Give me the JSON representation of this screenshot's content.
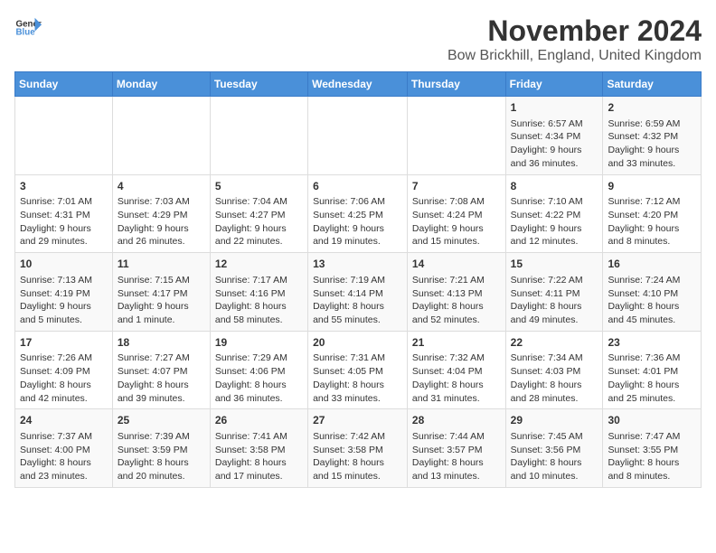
{
  "header": {
    "logo_general": "General",
    "logo_blue": "Blue",
    "month_year": "November 2024",
    "location": "Bow Brickhill, England, United Kingdom"
  },
  "weekdays": [
    "Sunday",
    "Monday",
    "Tuesday",
    "Wednesday",
    "Thursday",
    "Friday",
    "Saturday"
  ],
  "weeks": [
    [
      {
        "day": "",
        "info": ""
      },
      {
        "day": "",
        "info": ""
      },
      {
        "day": "",
        "info": ""
      },
      {
        "day": "",
        "info": ""
      },
      {
        "day": "",
        "info": ""
      },
      {
        "day": "1",
        "info": "Sunrise: 6:57 AM\nSunset: 4:34 PM\nDaylight: 9 hours and 36 minutes."
      },
      {
        "day": "2",
        "info": "Sunrise: 6:59 AM\nSunset: 4:32 PM\nDaylight: 9 hours and 33 minutes."
      }
    ],
    [
      {
        "day": "3",
        "info": "Sunrise: 7:01 AM\nSunset: 4:31 PM\nDaylight: 9 hours and 29 minutes."
      },
      {
        "day": "4",
        "info": "Sunrise: 7:03 AM\nSunset: 4:29 PM\nDaylight: 9 hours and 26 minutes."
      },
      {
        "day": "5",
        "info": "Sunrise: 7:04 AM\nSunset: 4:27 PM\nDaylight: 9 hours and 22 minutes."
      },
      {
        "day": "6",
        "info": "Sunrise: 7:06 AM\nSunset: 4:25 PM\nDaylight: 9 hours and 19 minutes."
      },
      {
        "day": "7",
        "info": "Sunrise: 7:08 AM\nSunset: 4:24 PM\nDaylight: 9 hours and 15 minutes."
      },
      {
        "day": "8",
        "info": "Sunrise: 7:10 AM\nSunset: 4:22 PM\nDaylight: 9 hours and 12 minutes."
      },
      {
        "day": "9",
        "info": "Sunrise: 7:12 AM\nSunset: 4:20 PM\nDaylight: 9 hours and 8 minutes."
      }
    ],
    [
      {
        "day": "10",
        "info": "Sunrise: 7:13 AM\nSunset: 4:19 PM\nDaylight: 9 hours and 5 minutes."
      },
      {
        "day": "11",
        "info": "Sunrise: 7:15 AM\nSunset: 4:17 PM\nDaylight: 9 hours and 1 minute."
      },
      {
        "day": "12",
        "info": "Sunrise: 7:17 AM\nSunset: 4:16 PM\nDaylight: 8 hours and 58 minutes."
      },
      {
        "day": "13",
        "info": "Sunrise: 7:19 AM\nSunset: 4:14 PM\nDaylight: 8 hours and 55 minutes."
      },
      {
        "day": "14",
        "info": "Sunrise: 7:21 AM\nSunset: 4:13 PM\nDaylight: 8 hours and 52 minutes."
      },
      {
        "day": "15",
        "info": "Sunrise: 7:22 AM\nSunset: 4:11 PM\nDaylight: 8 hours and 49 minutes."
      },
      {
        "day": "16",
        "info": "Sunrise: 7:24 AM\nSunset: 4:10 PM\nDaylight: 8 hours and 45 minutes."
      }
    ],
    [
      {
        "day": "17",
        "info": "Sunrise: 7:26 AM\nSunset: 4:09 PM\nDaylight: 8 hours and 42 minutes."
      },
      {
        "day": "18",
        "info": "Sunrise: 7:27 AM\nSunset: 4:07 PM\nDaylight: 8 hours and 39 minutes."
      },
      {
        "day": "19",
        "info": "Sunrise: 7:29 AM\nSunset: 4:06 PM\nDaylight: 8 hours and 36 minutes."
      },
      {
        "day": "20",
        "info": "Sunrise: 7:31 AM\nSunset: 4:05 PM\nDaylight: 8 hours and 33 minutes."
      },
      {
        "day": "21",
        "info": "Sunrise: 7:32 AM\nSunset: 4:04 PM\nDaylight: 8 hours and 31 minutes."
      },
      {
        "day": "22",
        "info": "Sunrise: 7:34 AM\nSunset: 4:03 PM\nDaylight: 8 hours and 28 minutes."
      },
      {
        "day": "23",
        "info": "Sunrise: 7:36 AM\nSunset: 4:01 PM\nDaylight: 8 hours and 25 minutes."
      }
    ],
    [
      {
        "day": "24",
        "info": "Sunrise: 7:37 AM\nSunset: 4:00 PM\nDaylight: 8 hours and 23 minutes."
      },
      {
        "day": "25",
        "info": "Sunrise: 7:39 AM\nSunset: 3:59 PM\nDaylight: 8 hours and 20 minutes."
      },
      {
        "day": "26",
        "info": "Sunrise: 7:41 AM\nSunset: 3:58 PM\nDaylight: 8 hours and 17 minutes."
      },
      {
        "day": "27",
        "info": "Sunrise: 7:42 AM\nSunset: 3:58 PM\nDaylight: 8 hours and 15 minutes."
      },
      {
        "day": "28",
        "info": "Sunrise: 7:44 AM\nSunset: 3:57 PM\nDaylight: 8 hours and 13 minutes."
      },
      {
        "day": "29",
        "info": "Sunrise: 7:45 AM\nSunset: 3:56 PM\nDaylight: 8 hours and 10 minutes."
      },
      {
        "day": "30",
        "info": "Sunrise: 7:47 AM\nSunset: 3:55 PM\nDaylight: 8 hours and 8 minutes."
      }
    ]
  ]
}
